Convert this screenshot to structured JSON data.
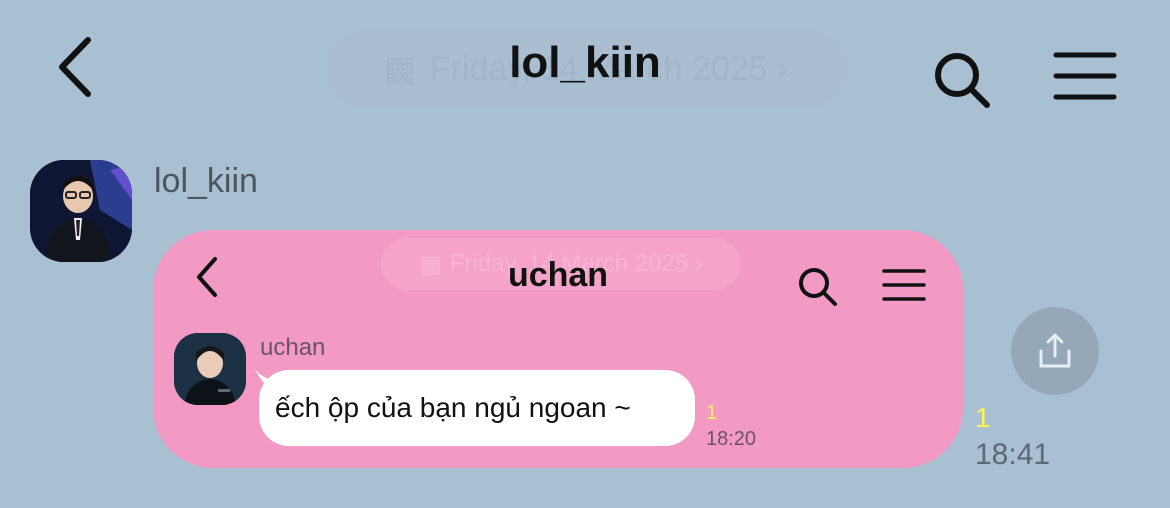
{
  "header": {
    "title": "lol_kiin",
    "date_banner": "Friday, 14 March 2025 ›"
  },
  "message": {
    "sender": "lol_kiin",
    "unread_count": "1",
    "time": "18:41"
  },
  "shared_screenshot": {
    "title": "uchan",
    "date_banner": "Friday, 14 March 2025 ›",
    "sender": "uchan",
    "text": "ếch ộp của bạn ngủ ngoan ~",
    "unread_count": "1",
    "time": "18:20"
  },
  "icons": {
    "back": "chevron-left-icon",
    "search": "search-icon",
    "menu": "hamburger-menu-icon",
    "share": "share-upload-icon"
  },
  "colors": {
    "background": "#a9bfd2",
    "bubble": "#f29ac4",
    "unread": "#fff45a"
  }
}
